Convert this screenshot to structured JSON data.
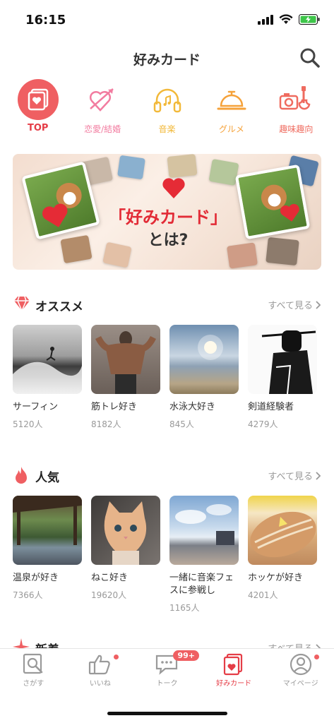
{
  "status": {
    "time": "16:15"
  },
  "header": {
    "title": "好みカード"
  },
  "categories": [
    {
      "label": "TOP",
      "icon": "card-heart-icon"
    },
    {
      "label": "恋愛/結婚",
      "icon": "heart-arrow-icon"
    },
    {
      "label": "音楽",
      "icon": "headphones-icon"
    },
    {
      "label": "グルメ",
      "icon": "cloche-icon"
    },
    {
      "label": "趣味趣向",
      "icon": "camera-guitar-icon"
    }
  ],
  "banner": {
    "title": "「好みカード」",
    "subtitle": "とは?"
  },
  "sections": {
    "recommended": {
      "title": "オススメ",
      "see_all": "すべて見る",
      "items": [
        {
          "name": "サーフィン",
          "count": "5120人"
        },
        {
          "name": "筋トレ好き",
          "count": "8182人"
        },
        {
          "name": "水泳大好き",
          "count": "845人"
        },
        {
          "name": "剣道経験者",
          "count": "4279人"
        }
      ]
    },
    "popular": {
      "title": "人気",
      "see_all": "すべて見る",
      "items": [
        {
          "name": "温泉が好き",
          "count": "7366人"
        },
        {
          "name": "ねこ好き",
          "count": "19620人"
        },
        {
          "name": "一緒に音楽フェスに参戦し",
          "count": "1165人"
        },
        {
          "name": "ホッケが好き",
          "count": "4201人"
        }
      ]
    },
    "new": {
      "title": "新着",
      "see_all": "すべて見る"
    }
  },
  "tabbar": {
    "items": [
      {
        "label": "さがす",
        "icon": "search-card-icon"
      },
      {
        "label": "いいね",
        "icon": "thumbs-up-icon"
      },
      {
        "label": "トーク",
        "icon": "chat-icon",
        "badge": "99+"
      },
      {
        "label": "好みカード",
        "icon": "card-heart-icon"
      },
      {
        "label": "マイページ",
        "icon": "person-icon"
      }
    ]
  },
  "colors": {
    "accent": "#ef5f62",
    "active_text": "#e53d47"
  }
}
